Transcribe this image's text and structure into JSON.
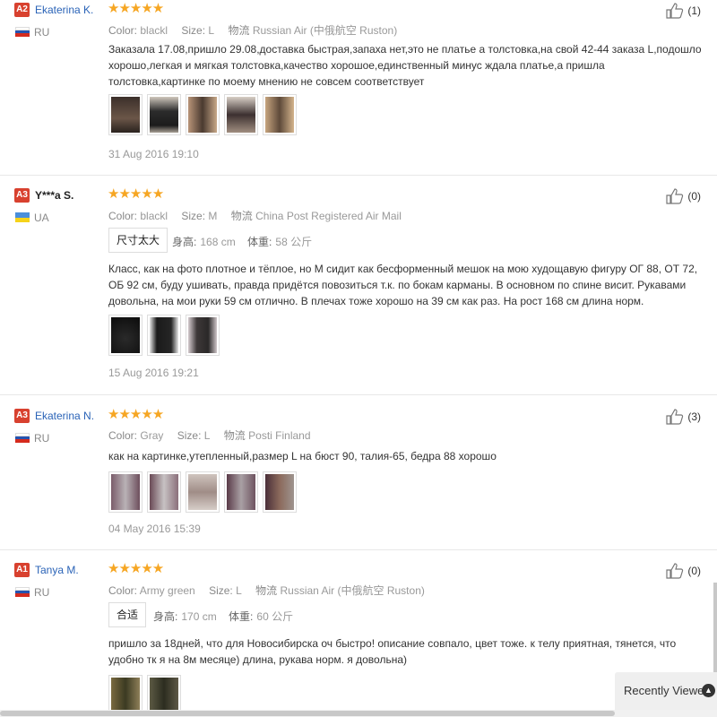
{
  "reviews": [
    {
      "level": "A2",
      "name": "Ekaterina K.",
      "country": "RU",
      "likes": "(1)",
      "stars": "★★★★★",
      "color_label": "Color:",
      "color": "blackl",
      "size_label": "Size:",
      "size": "L",
      "ship_label": "物流",
      "ship": "Russian Air (中俄航空 Ruston)",
      "text": "Заказала 17.08,пришло 29.08,доставка быстрая,запаха нет,это не платье а толстовка,на свой 42-44 заказа L,подошло хорошо,легкая и мягкая толстовка,качество хорошое,единственный минус ждала платье,а пришла толстовка,картинке по моему мнению не совсем соответствует",
      "date": "31 Aug 2016 19:10"
    },
    {
      "level": "A3",
      "name": "Y***a S.",
      "country": "UA",
      "likes": "(0)",
      "stars": "★★★★★",
      "color_label": "Color:",
      "color": "blackl",
      "size_label": "Size:",
      "size": "M",
      "ship_label": "物流",
      "ship": "China Post Registered Air Mail",
      "fit": "尺寸太大",
      "height_label": "身高:",
      "height": "168 cm",
      "weight_label": "体重:",
      "weight": "58 公斤",
      "text": "Класс, как на фото плотное и тёплое, но М сидит как бесформенный мешок на мою худощавую фигуру ОГ 88, ОТ 72, ОБ 92 см, буду ушивать, правда придётся повозиться т.к. по бокам карманы. В основном по спине висит. Рукавами довольна, на мои руки 59 см отлично. В плечах тоже хорошо на 39 см как раз. На рост 168 см длина норм.",
      "date": "15 Aug 2016 19:21"
    },
    {
      "level": "A3",
      "name": "Ekaterina N.",
      "country": "RU",
      "likes": "(3)",
      "stars": "★★★★★",
      "color_label": "Color:",
      "color": "Gray",
      "size_label": "Size:",
      "size": "L",
      "ship_label": "物流",
      "ship": "Posti Finland",
      "text": "как на картинке,утепленный,размер L на бюст 90, талия-65, бедра 88 хорошо",
      "date": "04 May 2016 15:39"
    },
    {
      "level": "A1",
      "name": "Tanya M.",
      "country": "RU",
      "likes": "(0)",
      "stars": "★★★★★",
      "color_label": "Color:",
      "color": "Army green",
      "size_label": "Size:",
      "size": "L",
      "ship_label": "物流",
      "ship": "Russian Air (中俄航空 Ruston)",
      "fit": "合适",
      "height_label": "身高:",
      "height": "170 cm",
      "weight_label": "体重:",
      "weight": "60 公斤",
      "text": "пришло за 18дней, что для Новосибирска оч быстро! описание совпало, цвет тоже. к телу приятная, тянется, что удобно тк я на 8м месяце) длина, рукава норм. я довольна)"
    }
  ],
  "recently_viewed": "Recently Viewed",
  "colors": {
    "accent_star": "#f6a623",
    "level_badge": "#d8412f",
    "name_link": "#2a63b7"
  }
}
